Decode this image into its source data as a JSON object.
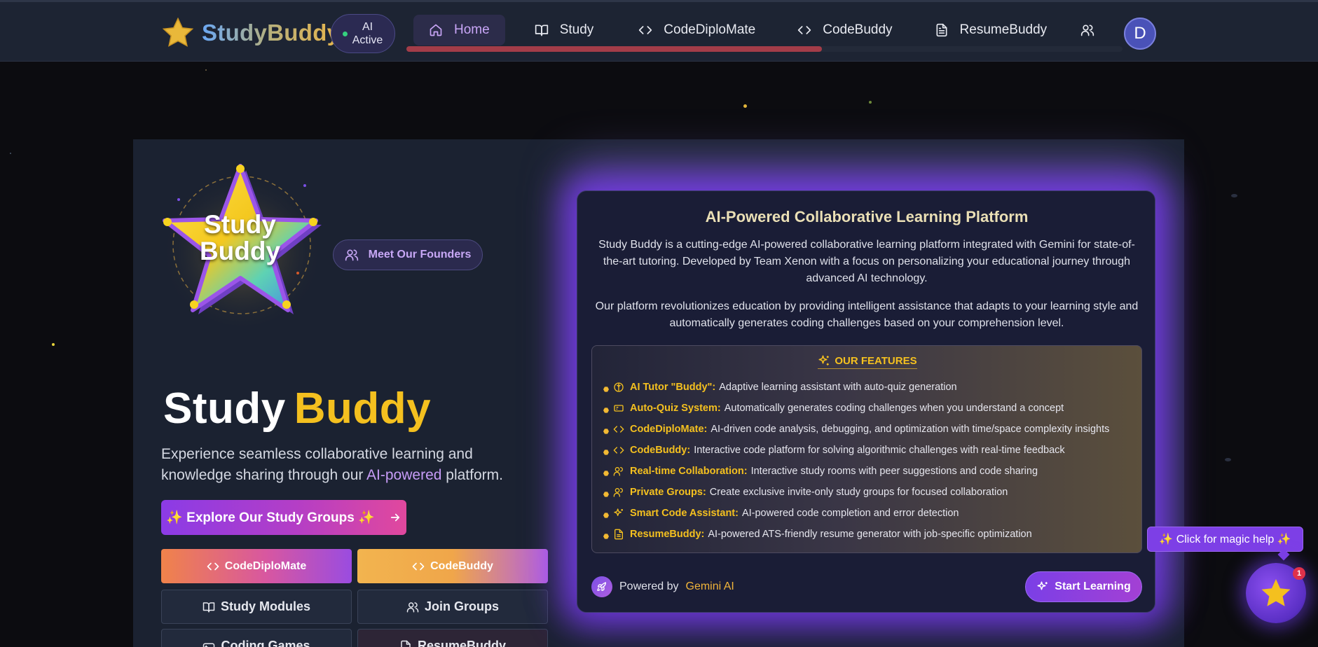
{
  "navbar": {
    "brand": "StudyBuddy",
    "ai_status": "AI Active",
    "items": [
      {
        "label": "Home",
        "icon": "home-icon",
        "active": true
      },
      {
        "label": "Study",
        "icon": "book-icon",
        "active": false
      },
      {
        "label": "CodeDiploMate",
        "icon": "code-icon",
        "active": false
      },
      {
        "label": "CodeBuddy",
        "icon": "code-icon",
        "active": false
      },
      {
        "label": "ResumeBuddy",
        "icon": "file-text-icon",
        "active": false
      }
    ],
    "progress": 0.58,
    "avatar_initial": "D"
  },
  "hero": {
    "logo_text_line1": "Study",
    "logo_text_line2": "Buddy",
    "founders_button": "Meet Our Founders",
    "title_word1": "Study",
    "title_word2": "Buddy",
    "subtitle_before": "Experience seamless collaborative learning and knowledge sharing through our ",
    "subtitle_highlight": "AI-powered",
    "subtitle_after": " platform.",
    "explore_button": "✨ Explore Our Study Groups ✨",
    "quick_links": {
      "codediplomate": "CodeDiploMate",
      "codebuddy": "CodeBuddy",
      "study_modules": "Study Modules",
      "join_groups": "Join Groups",
      "coding_games": "Coding Games",
      "resumebuddy": "ResumeBuddy"
    }
  },
  "card": {
    "title": "AI-Powered Collaborative Learning Platform",
    "paragraph1": "Study Buddy is a cutting-edge AI-powered collaborative learning platform integrated with Gemini for state-of-the-art tutoring. Developed by Team Xenon with a focus on personalizing your educational journey through advanced AI technology.",
    "paragraph2": "Our platform revolutionizes education by providing intelligent assistance that adapts to your learning style and automatically generates coding challenges based on your comprehension level.",
    "features_heading": "OUR FEATURES",
    "features": [
      {
        "name": "AI Tutor \"Buddy\":",
        "desc": "Adaptive learning assistant with auto-quiz generation",
        "icon": "brain-icon"
      },
      {
        "name": "Auto-Quiz System:",
        "desc": "Automatically generates coding challenges when you understand a concept",
        "icon": "quiz-card-icon"
      },
      {
        "name": "CodeDiploMate:",
        "desc": "AI-driven code analysis, debugging, and optimization with time/space complexity insights",
        "icon": "code-icon"
      },
      {
        "name": "CodeBuddy:",
        "desc": "Interactive code platform for solving algorithmic challenges with real-time feedback",
        "icon": "code-icon"
      },
      {
        "name": "Real-time Collaboration:",
        "desc": "Interactive study rooms with peer suggestions and code sharing",
        "icon": "users-icon"
      },
      {
        "name": "Private Groups:",
        "desc": "Create exclusive invite-only study groups for focused collaboration",
        "icon": "users-icon"
      },
      {
        "name": "Smart Code Assistant:",
        "desc": "AI-powered code completion and error detection",
        "icon": "sparkles-icon"
      },
      {
        "name": "ResumeBuddy:",
        "desc": "AI-powered ATS-friendly resume generator with job-specific optimization",
        "icon": "file-text-icon"
      }
    ],
    "powered_by": "Powered by",
    "powered_by_brand": "Gemini AI",
    "start_button": "Start Learning"
  },
  "magic_help": {
    "tooltip": "✨ Click for magic help ✨",
    "badge_count": "1"
  },
  "colors": {
    "accent_purple": "#7b3fe6",
    "brand_gold": "#f4c01f",
    "page_bg": "#0c0c10",
    "panel_bg": "#1b2231"
  }
}
